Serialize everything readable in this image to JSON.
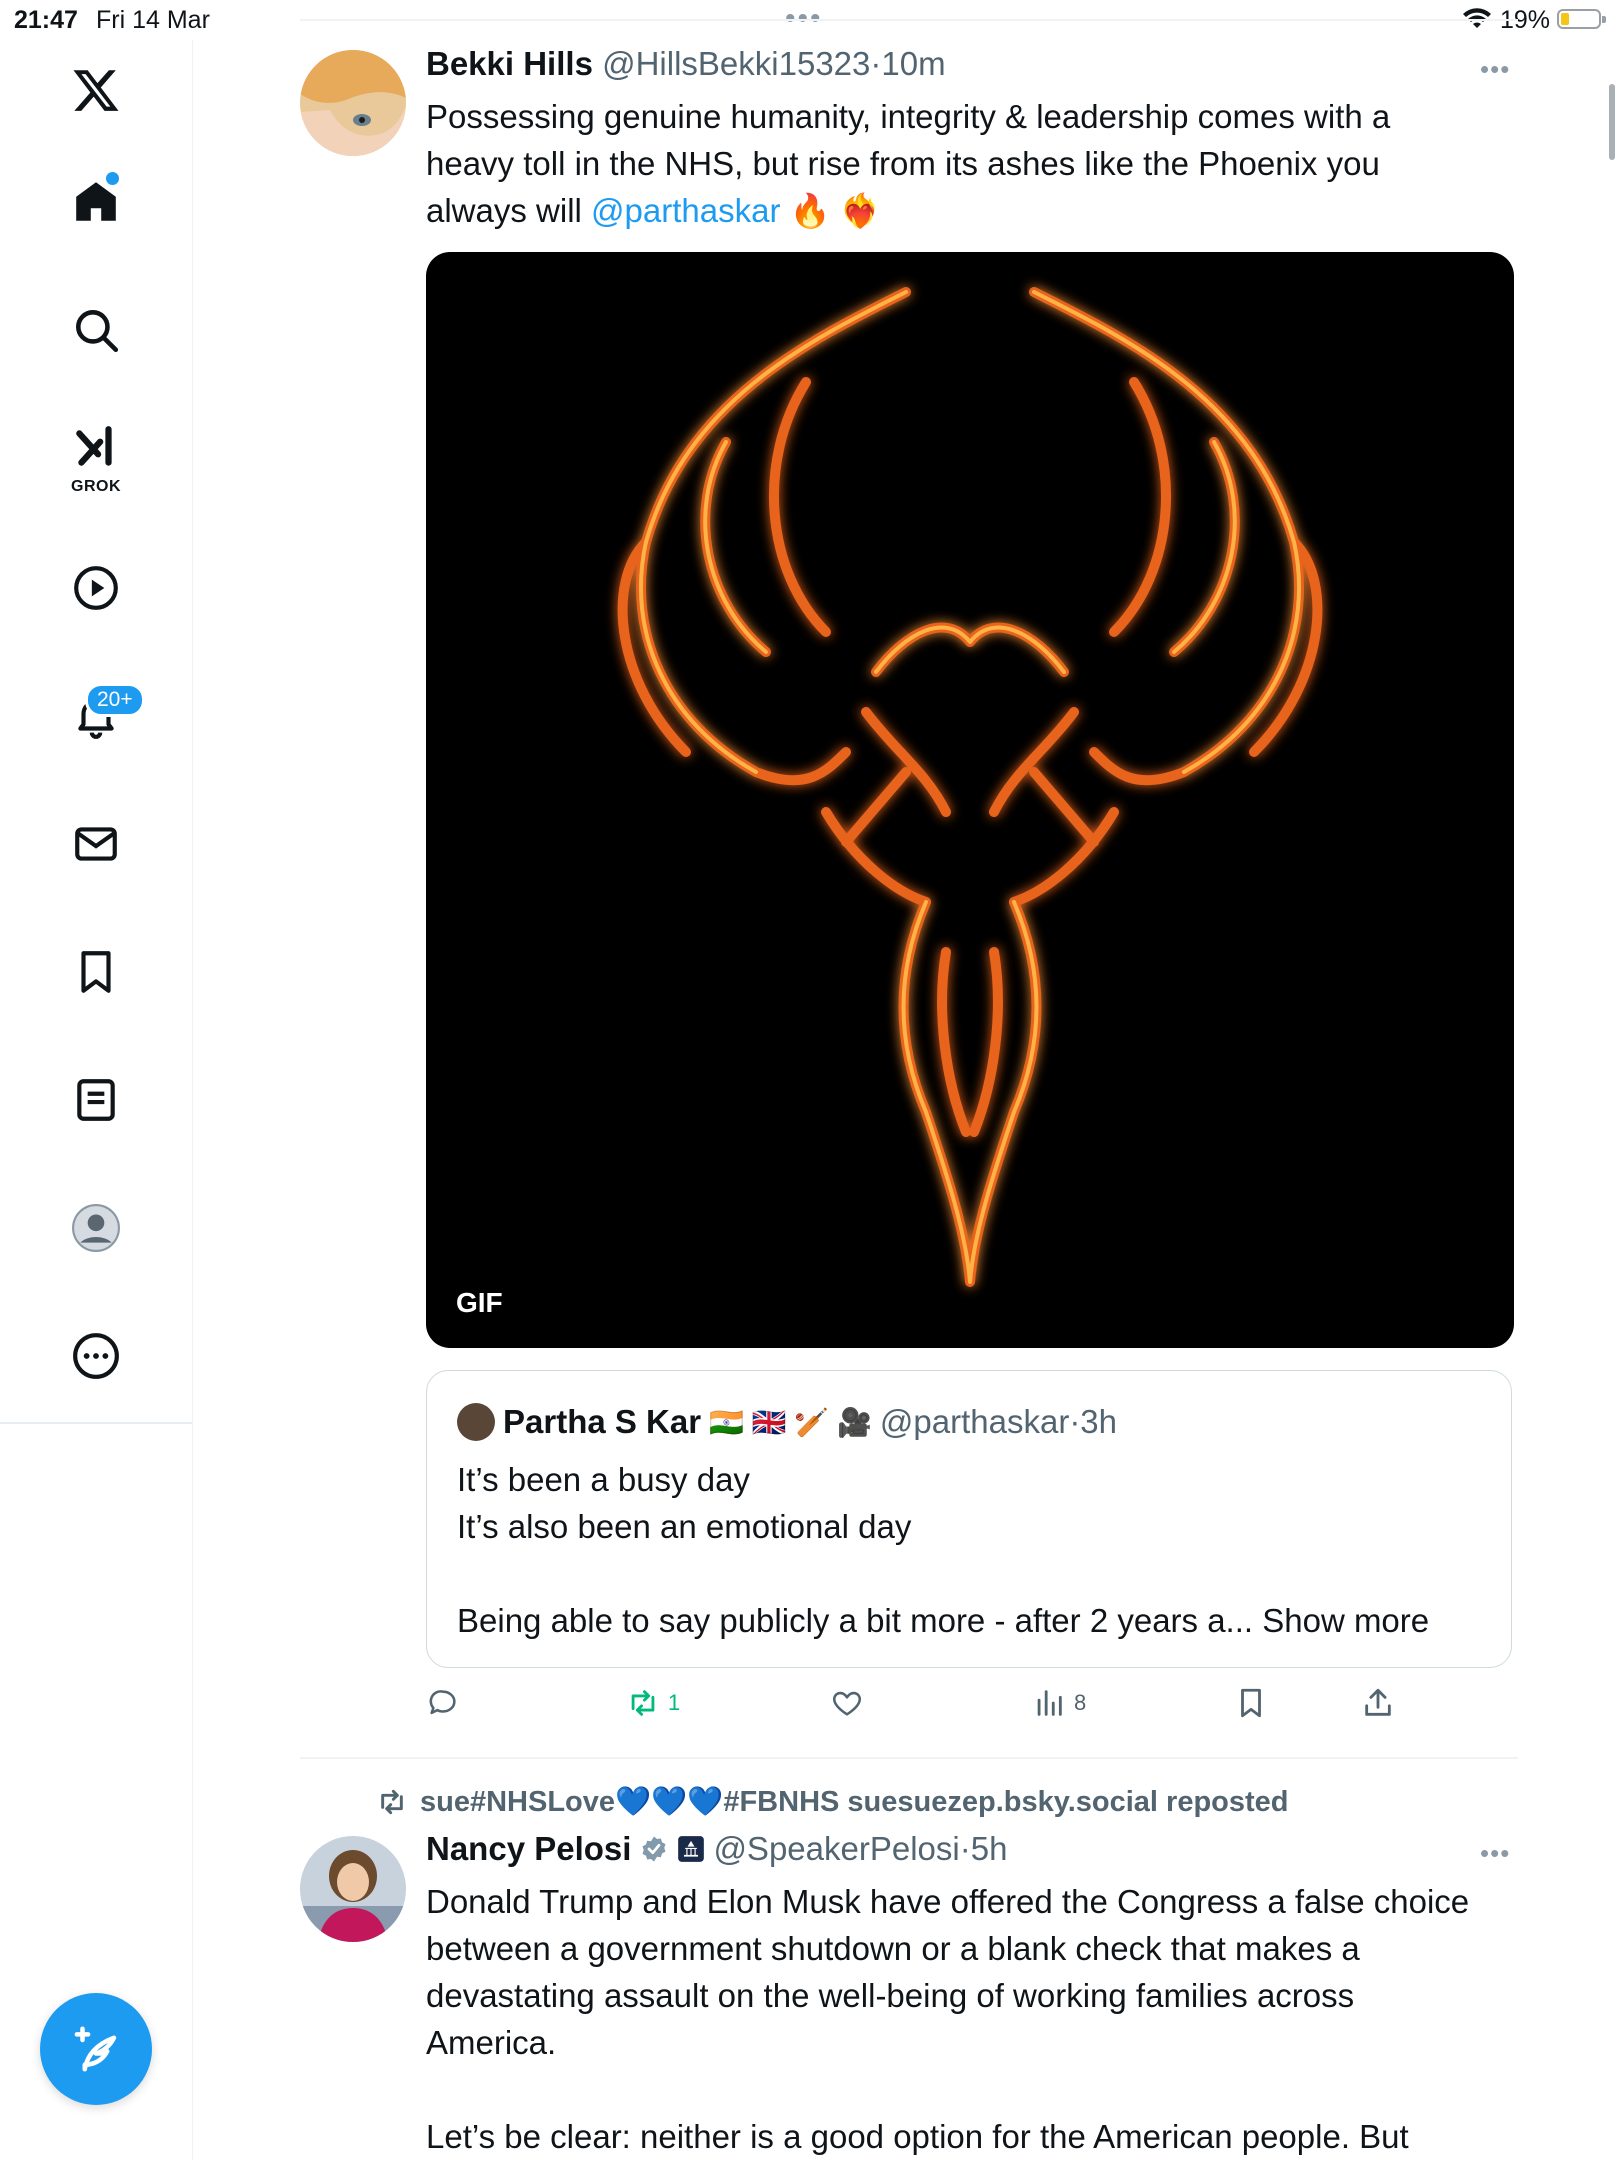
{
  "status_bar": {
    "time": "21:47",
    "date": "Fri 14 Mar",
    "battery": "19%"
  },
  "sidebar": {
    "grok_label": "GROK",
    "notifications_badge": "20+"
  },
  "tweet1": {
    "name": "Bekki Hills",
    "handle": "@HillsBekki15323",
    "time": "·10m",
    "text_line1": "Possessing genuine humanity, integrity & leadership comes with a",
    "text_line2": "heavy toll in the NHS, but rise from its ashes like the Phoenix you",
    "text_line3_prefix": "always will ",
    "mention": "@parthaskar",
    "emoji": " 🔥 ❤️‍🔥",
    "media_label": "GIF",
    "quote": {
      "name": "Partha S Kar",
      "flags": "🇮🇳 🇬🇧 🏏 🎥",
      "handle": "@parthaskar",
      "time": "·3h",
      "line1": "It’s been a busy day",
      "line2": "It’s also been an emotional day",
      "line3": "Being able to say publicly a bit more - after 2 years a...",
      "show_more": " Show more"
    },
    "actions": {
      "retweets": "1",
      "views": "8"
    }
  },
  "tweet2": {
    "repost_by": "sue#NHSLove💙💙💙#FBNHS suesuezep.bsky.social reposted",
    "name": "Nancy Pelosi",
    "handle": "@SpeakerPelosi",
    "time": "·5h",
    "text_line1": "Donald Trump and Elon Musk have offered the Congress a false choice",
    "text_line2": "between a government shutdown or a blank check that makes a",
    "text_line3": "devastating assault on the well-being of working families across",
    "text_line4": "America.",
    "text_line5": "Let’s be clear: neither is a good option for the American people. But"
  },
  "colors": {
    "accent": "#1d9bf0",
    "retweet_green": "#00ba7c",
    "muted": "#536471"
  }
}
